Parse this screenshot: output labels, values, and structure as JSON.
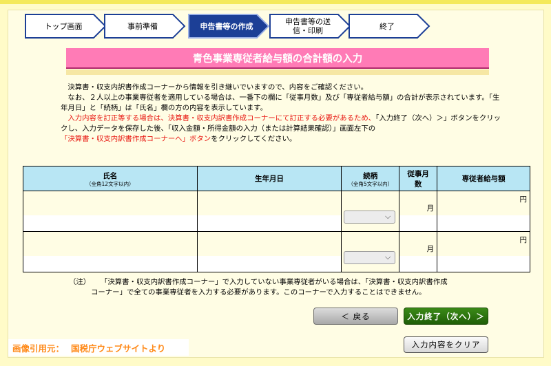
{
  "steps": [
    {
      "label": "トップ画面"
    },
    {
      "label": "事前準備"
    },
    {
      "label": "申告書等の作成",
      "active": true
    },
    {
      "label": "申告書等の送信・印刷"
    },
    {
      "label": "終了"
    }
  ],
  "page_title": "青色事業専従者給与額の合計額の入力",
  "intro": {
    "line1": "決算書・収支内訳書作成コーナーから情報を引き継いでいますので、内容をご確認ください。",
    "line2": "なお、２人以上の事業専従者を適用している場合は、一番下の欄に「従事月数」及び「専従者給与額」の合計が表示されています。「生年月日」と「続柄」は「氏名」欄の方の内容を表示しています。",
    "line3_red": "入力内容を訂正等する場合は、決算書・収支内訳書作成コーナーにて訂正する必要があるため、",
    "line3_black": "「入力終了（次へ）＞」ボタンをクリックし、入力データを保存した後、「収入金額・所得金額の入力（または計算結果確認）」画面左下の",
    "line4_red": "「決算書・収支内訳書作成コーナーへ」ボタン",
    "line4_black": "をクリックしてください。"
  },
  "table": {
    "headers": {
      "name": "氏名",
      "name_note": "（全角12文字以内）",
      "dob": "生年月日",
      "relation": "続柄",
      "relation_note": "（全角5文字以内）",
      "months": "従事月数",
      "salary": "専従者給与額"
    },
    "month_unit": "月",
    "yen_unit": "円",
    "rows": [
      {
        "name": "",
        "dob": "",
        "relation": "",
        "months": "",
        "salary": ""
      },
      {
        "name": "",
        "dob": "",
        "relation": "",
        "months": "",
        "salary": ""
      }
    ]
  },
  "note": {
    "prefix": "（注）",
    "line1": "「決算書・収支内訳書作成コーナー」で入力していない事業専従者がいる場合は、「決算書・収支内訳書作成",
    "line2": "コーナー」で全ての事業専従者を入力する必要があります。このコーナーで入力することはできません。"
  },
  "buttons": {
    "back": "＜ 戻る",
    "next": "入力終了（次へ）＞",
    "clear": "入力内容をクリア"
  },
  "credit": {
    "label": "画像引用元：",
    "source": "国税庁ウェブサイトより"
  },
  "colors": {
    "background": "#fffbc8",
    "title_pink": "#ff7bb6",
    "active_step": "#1c3f96",
    "table_header": "#b8e6f4",
    "next_button": "#2e7a10",
    "warning_red": "#e8150f",
    "credit_orange": "#ff8a1a"
  }
}
